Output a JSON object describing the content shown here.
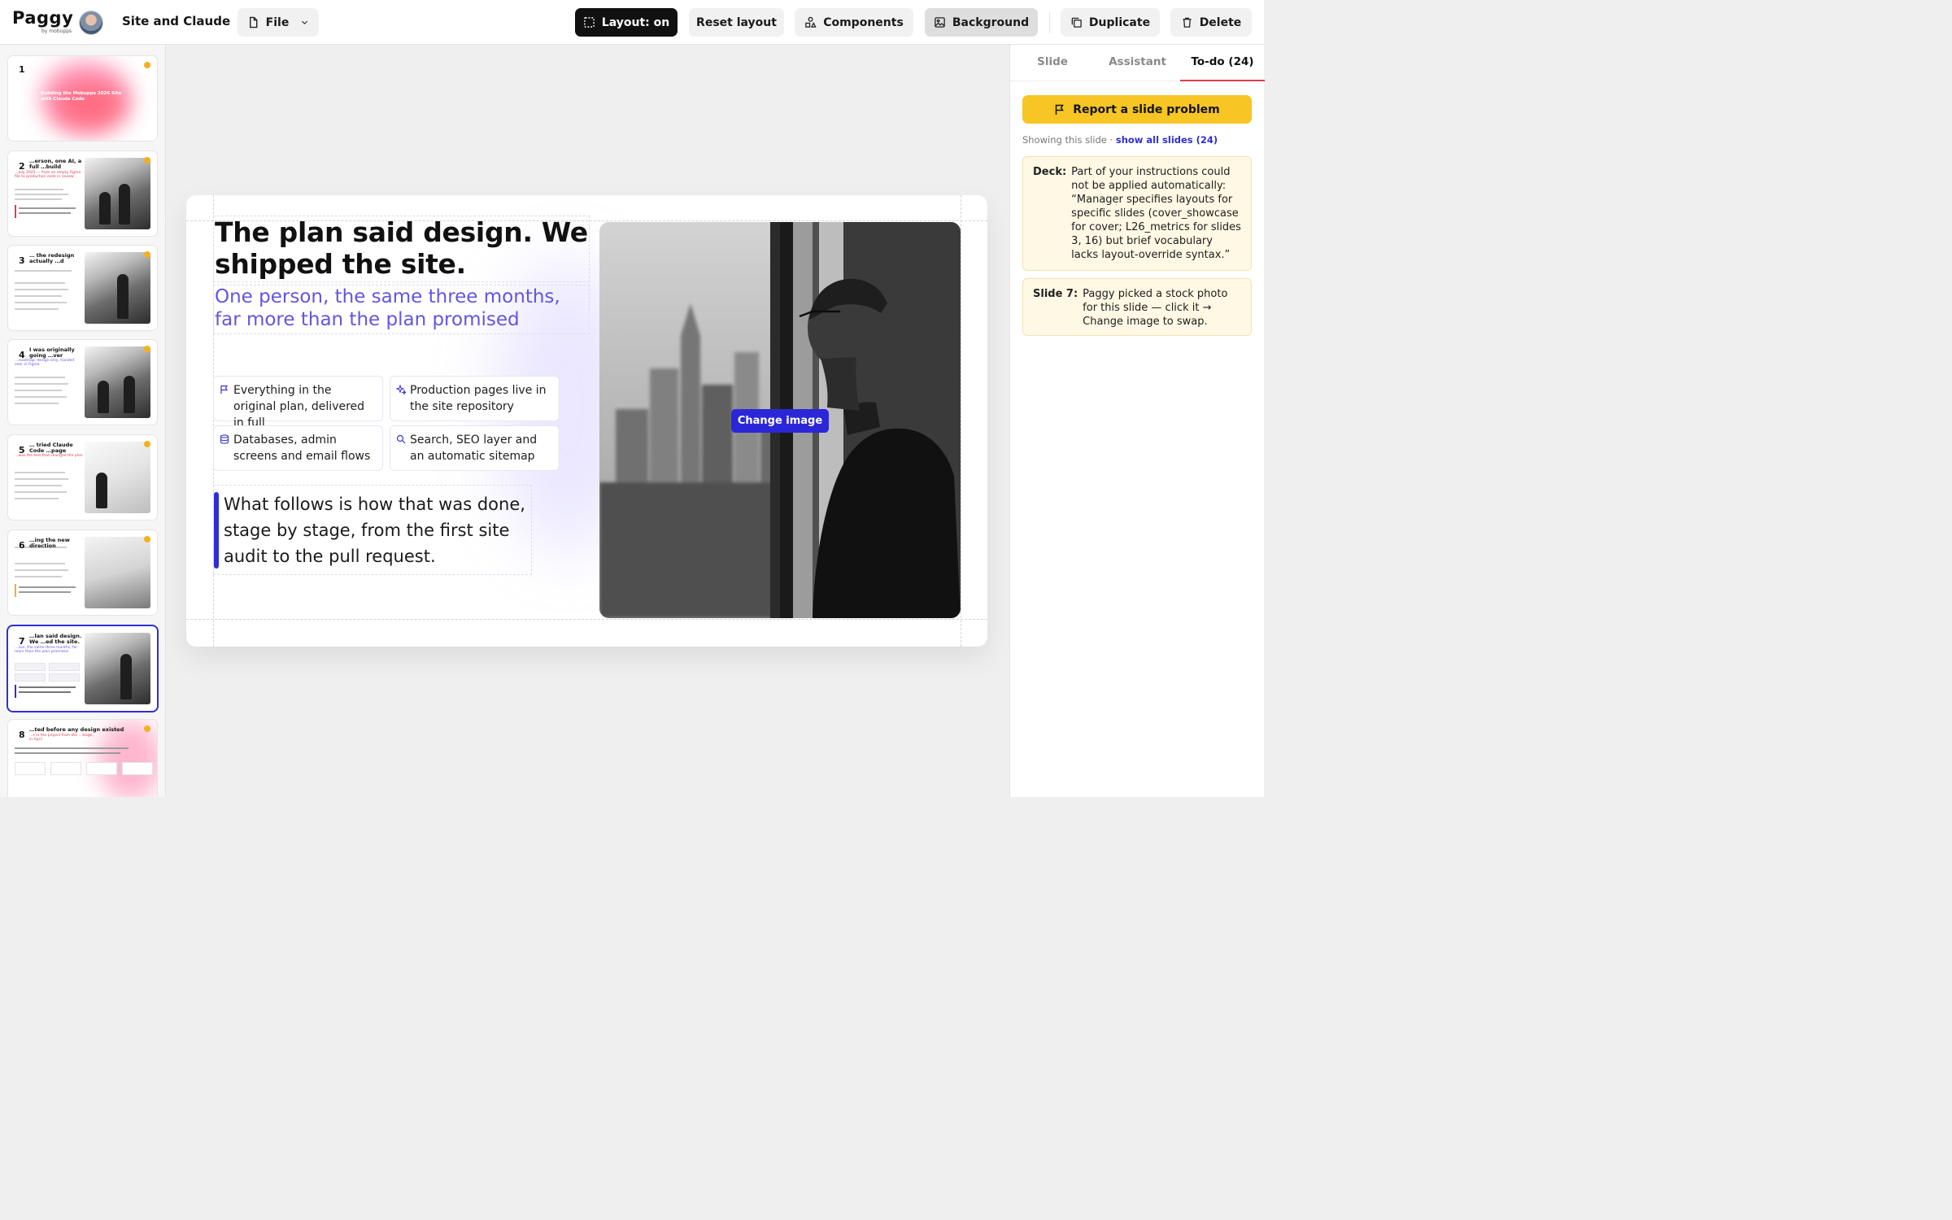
{
  "app": {
    "logo_text": "Paggy",
    "logo_sub": "by mobupps",
    "project_title": "Site and Claude"
  },
  "toolbar": {
    "file_label": "File",
    "layout_label": "Layout: on",
    "reset_label": "Reset layout",
    "components_label": "Components",
    "background_label": "Background",
    "duplicate_label": "Duplicate",
    "delete_label": "Delete"
  },
  "thumbnails": [
    {
      "num": "1",
      "title": "Building the Mobupps 2026 Site with Claude Code",
      "sub": ""
    },
    {
      "num": "2",
      "title": "…erson, one AI, a full …build",
      "sub": "…July 2025 — from an empty Figma file to production code in review"
    },
    {
      "num": "3",
      "title": "… the redesign actually …d",
      "sub": ""
    },
    {
      "num": "4",
      "title": "I was originally going …ver",
      "sub": "…roadmap: design only, handed over in Figma"
    },
    {
      "num": "5",
      "title": "… tried Claude Code …page",
      "sub": "…was the test that changed the plan"
    },
    {
      "num": "6",
      "title": "…ing the new direction",
      "sub": ""
    },
    {
      "num": "7",
      "title": "…lan said design. We …ed the site.",
      "sub": "…son, the same three months, far more than the plan promised"
    },
    {
      "num": "8",
      "title": "…ted before any design existed",
      "sub": "…s in the project from the …stage, in April"
    }
  ],
  "slide": {
    "title": "The plan said design. We shipped the site.",
    "subtitle": "One person, the same three months, far more than the plan promised",
    "cards": [
      {
        "icon": "flag-icon",
        "text": "Everything in the original plan, delivered in full"
      },
      {
        "icon": "sparkle-icon",
        "text": "Production pages live in the site repository"
      },
      {
        "icon": "database-icon",
        "text": "Databases, admin screens and email flows"
      },
      {
        "icon": "search-icon",
        "text": "Search, SEO layer and an automatic sitemap"
      }
    ],
    "quote": "What follows is how that was done, stage by stage, from the first site audit to the pull request.",
    "change_image_label": "Change image"
  },
  "panel": {
    "tabs": [
      "Slide",
      "Assistant",
      "To-do (24)"
    ],
    "active_tab": "To-do (24)",
    "report_label": "Report a slide problem",
    "showing_prefix": "Showing this slide · ",
    "showing_link": "show all slides (24)",
    "notes": [
      {
        "label": "Deck:",
        "text": "Part of your instructions could not be applied automatically: “Manager specifies layouts for specific slides (cover_showcase for cover; L26_metrics for slides 3, 16) but brief vocabulary lacks layout-override syntax.”"
      },
      {
        "label": "Slide 7:",
        "text": "Paggy picked a stock photo for this slide — click it → Change image to swap."
      }
    ]
  },
  "colors": {
    "accent": "#2f2ed6",
    "subtitle": "#6156e3",
    "report_button": "#f7c524",
    "status_dot": "#f6b01c",
    "tab_underline": "#e23b4d"
  }
}
